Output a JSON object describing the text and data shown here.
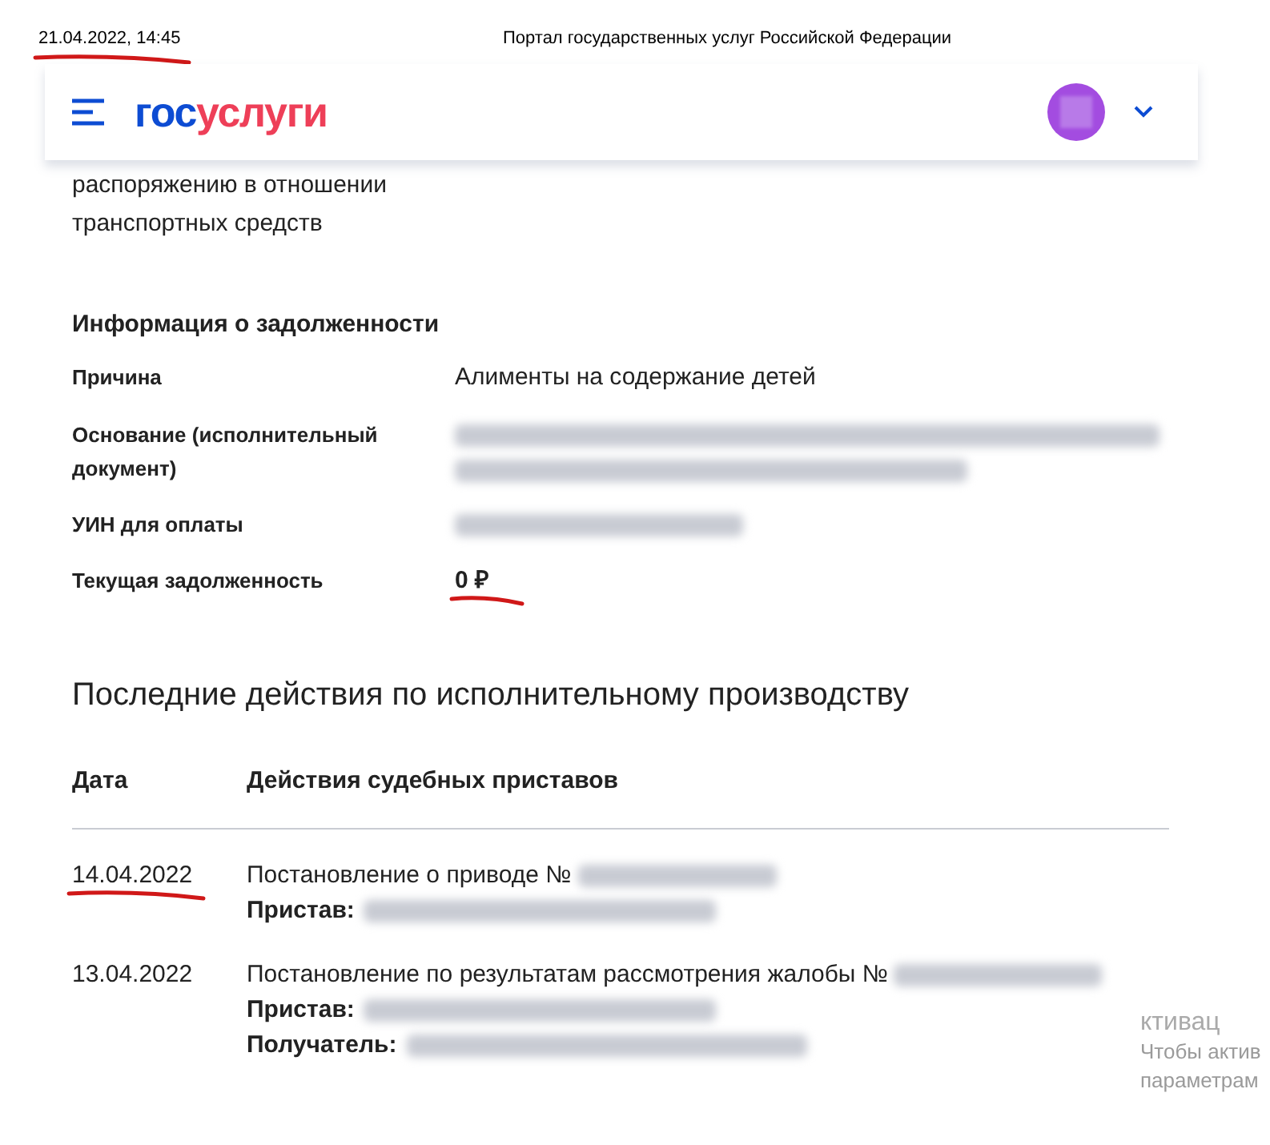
{
  "print_header": {
    "timestamp": "21.04.2022, 14:45",
    "title": "Портал государственных услуг Российской Федерации"
  },
  "header": {
    "logo_first": "гос",
    "logo_second": "услуги"
  },
  "vehicle_row": {
    "label": "распоряжению в отношении транспортных средств"
  },
  "debt": {
    "title": "Информация о задолженности",
    "rows": [
      {
        "label": "Причина",
        "value": "Алименты на содержание детей",
        "kind": "text"
      },
      {
        "label": "Основание (исполнительный документ)",
        "kind": "redacted"
      },
      {
        "label": "УИН для оплаты",
        "kind": "redacted"
      },
      {
        "label": "Текущая задолженность",
        "value": "0 ₽",
        "kind": "amount"
      }
    ]
  },
  "actions": {
    "title": "Последние действия по исполнительному производству",
    "columns": [
      "Дата",
      "Действия судебных приставов"
    ],
    "rows": [
      {
        "date": "14.04.2022",
        "action": "Постановление о приводе №",
        "fields": [
          "Пристав:"
        ]
      },
      {
        "date": "13.04.2022",
        "action": "Постановление по результатам рассмотрения жалобы №",
        "fields": [
          "Пристав:",
          "Получатель:"
        ]
      }
    ]
  },
  "activation_notice": [
    "ктивац",
    "Чтобы актив",
    "параметрам"
  ]
}
